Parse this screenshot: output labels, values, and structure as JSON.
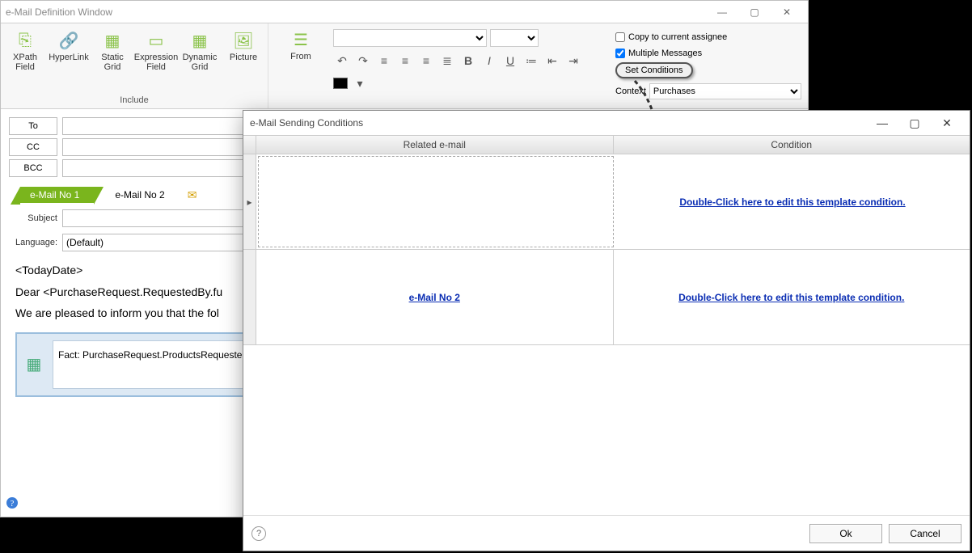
{
  "window": {
    "title": "e-Mail Definition Window",
    "btn_min": "—",
    "btn_max": "▢",
    "btn_close": "✕"
  },
  "ribbon": {
    "include_caption": "Include",
    "items": {
      "xpath": "XPath\nField",
      "hyperlink": "HyperLink",
      "staticgrid": "Static\nGrid",
      "exprfield": "Expression\nField",
      "dyngrid": "Dynamic\nGrid",
      "picture": "Picture"
    },
    "from": "From"
  },
  "options": {
    "copy_assignee": "Copy to current assignee",
    "multiple_messages": "Multiple Messages",
    "set_conditions": "Set Conditions",
    "context_label": "Context",
    "context_value": "Purchases"
  },
  "addr": {
    "to": "To",
    "cc": "CC",
    "bcc": "BCC"
  },
  "tabs": {
    "t1": "e-Mail No  1",
    "t2": "e-Mail No  2"
  },
  "fields": {
    "subject_label": "Subject",
    "language_label": "Language:",
    "language_value": "(Default)"
  },
  "body": {
    "line1": "<TodayDate>",
    "line2": "Dear <PurchaseRequest.RequestedBy.fu",
    "line3": "We are pleased to inform you that the fol",
    "fact": "Fact: PurchaseRequest.ProductsRequested"
  },
  "dialog": {
    "title": "e-Mail Sending Conditions",
    "col1": "Related e-mail",
    "col2": "Condition",
    "row1_right": "Double-Click here to edit this template condition.",
    "row2_left": "e-Mail No  2",
    "row2_right": "Double-Click here to edit this template condition.",
    "ok": "Ok",
    "cancel": "Cancel"
  }
}
